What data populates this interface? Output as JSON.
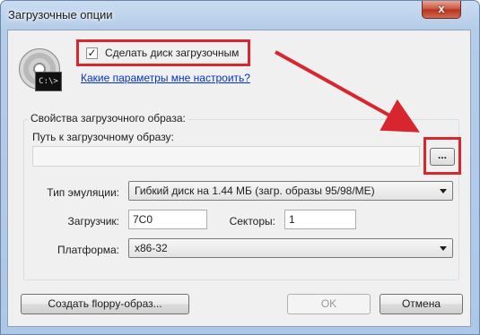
{
  "window": {
    "title": "Загрузочные опции",
    "close_label": "x"
  },
  "boot": {
    "make_bootable_label": "Сделать диск загрузочным",
    "make_bootable_checked": true,
    "check_mark": "✓",
    "help_link": "Какие параметры мне настроить?",
    "cmd_icon_text": "C:\\>"
  },
  "image_props": {
    "group_title": "Свойства загрузочного образа:",
    "path_label": "Путь к загрузочному образу:",
    "path_value": "",
    "browse_label": "...",
    "emulation_label": "Тип эмуляции:",
    "emulation_value": "Гибкий диск на 1.44 МБ (загр. образы 95/98/ME)",
    "loader_label": "Загрузчик:",
    "loader_value": "7C0",
    "sectors_label": "Секторы:",
    "sectors_value": "1",
    "platform_label": "Платформа:",
    "platform_value": "x86-32"
  },
  "buttons": {
    "create_floppy": "Создать floppy-образ...",
    "ok": "OK",
    "cancel": "Отмена"
  },
  "colors": {
    "highlight": "#d9262e",
    "link": "#0033cc"
  },
  "icons": {
    "disc": "optical-disc-icon",
    "cmd": "command-prompt-icon",
    "dropdown": "chevron-down-icon"
  }
}
